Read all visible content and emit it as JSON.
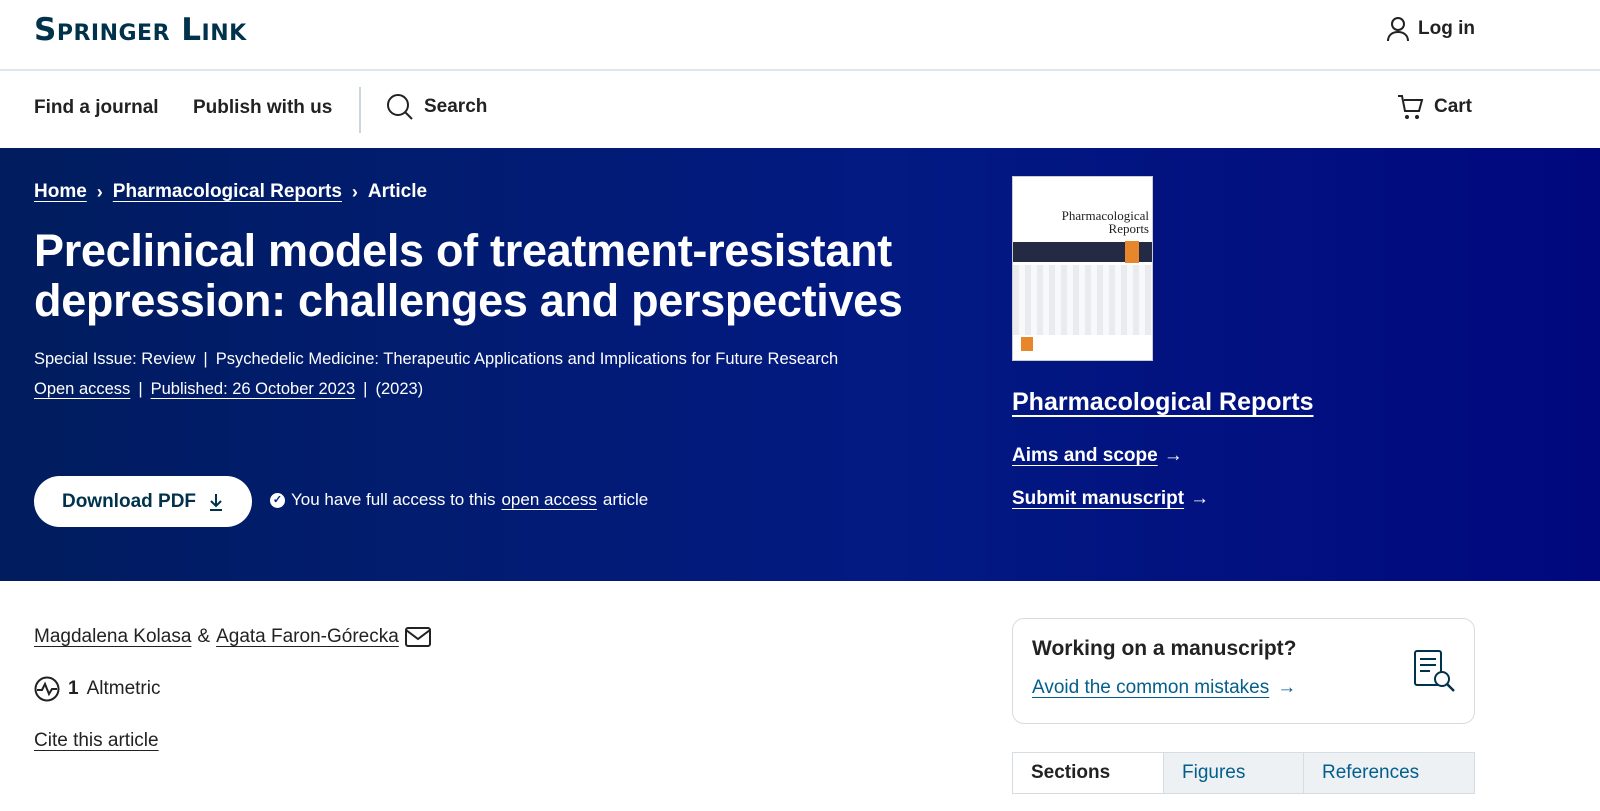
{
  "header": {
    "logo": "Springer Link",
    "login_label": "Log in"
  },
  "nav": {
    "find_journal": "Find a journal",
    "publish": "Publish with us",
    "search": "Search",
    "cart": "Cart"
  },
  "breadcrumb": [
    {
      "label": "Home"
    },
    {
      "label": "Pharmacological Reports"
    },
    {
      "label": "Article"
    }
  ],
  "article": {
    "title": "Preclinical models of treatment-resistant depression: challenges and perspectives",
    "special_issue": "Special Issue: Review",
    "issue_topic": "Psychedelic Medicine: Therapeutic Applications and Implications for Future Research",
    "open_access": "Open access",
    "published": "Published: 26 October 2023",
    "year": "(2023)",
    "download_label": "Download PDF",
    "access_prefix": "You have full access to this",
    "access_link": "open access",
    "access_suffix": "article",
    "authors": [
      "Magdalena Kolasa",
      "Agata Faron-Górecka"
    ],
    "author_joiner": "&",
    "altmetric_count": "1",
    "altmetric_label": "Altmetric",
    "cite_label": "Cite this article"
  },
  "journal": {
    "cover_title": "Pharmacological Reports",
    "name": "Pharmacological Reports",
    "aims_label": "Aims and scope",
    "submit_label": "Submit manuscript"
  },
  "manuscript_box": {
    "title": "Working on a manuscript?",
    "link_label": "Avoid the common mistakes"
  },
  "tabs": [
    {
      "label": "Sections",
      "active": true
    },
    {
      "label": "Figures",
      "active": false
    },
    {
      "label": "References",
      "active": false
    }
  ],
  "colors": {
    "brand_dark": "#01324b",
    "hero_blue": "#021a82",
    "link_blue": "#025e8d"
  }
}
